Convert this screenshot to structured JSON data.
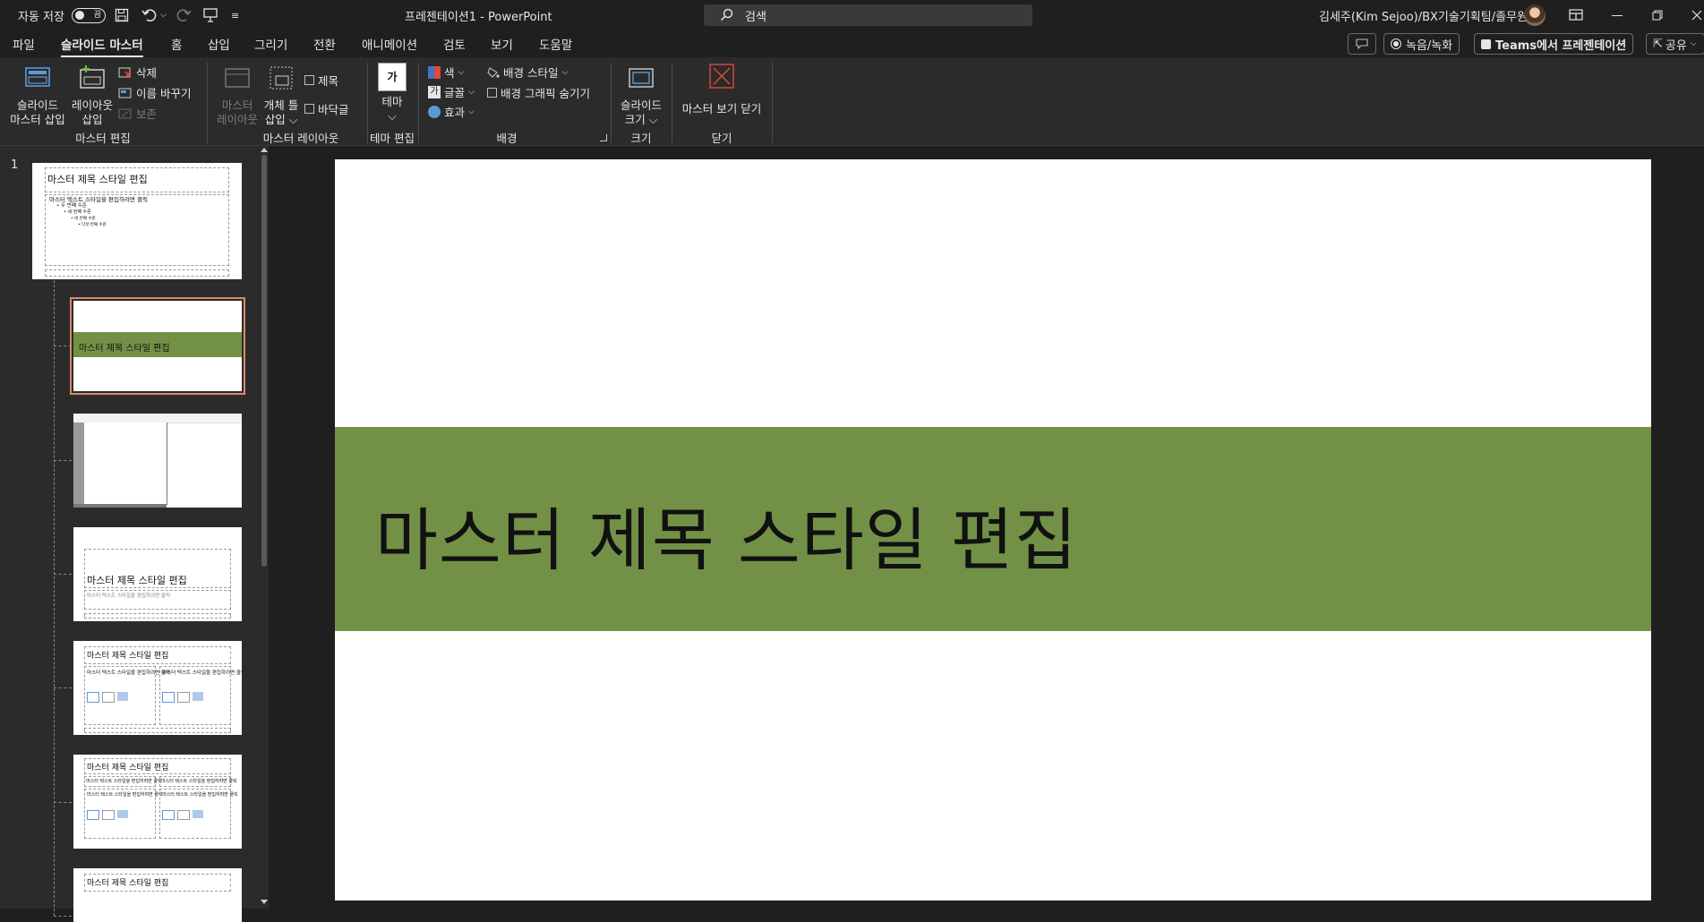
{
  "titlebar": {
    "autosave_label": "자동 저장",
    "autosave_state": "끔",
    "doc_title": "프레젠테이션1  -  PowerPoint",
    "search_placeholder": "검색",
    "user": "김세주(Kim Sejoo)/BX기술기획팀/졸무원"
  },
  "tabs": [
    "파일",
    "슬라이드 마스터",
    "홈",
    "삽입",
    "그리기",
    "전환",
    "애니메이션",
    "검토",
    "보기",
    "도움말"
  ],
  "tabs_active_index": 1,
  "ribbon_right": {
    "record": "녹음/녹화",
    "teams": "Teams에서 프레젠테이션",
    "share": "공유"
  },
  "ribbon": {
    "insert_master": "슬라이드\n마스터 삽입",
    "insert_master_l1": "슬라이드",
    "insert_master_l2": "마스터 삽입",
    "insert_layout_l1": "레이아웃",
    "insert_layout_l2": "삽입",
    "delete": "삭제",
    "rename": "이름 바꾸기",
    "preserve": "보존",
    "group_master_edit": "마스터 편집",
    "master_layout_l1": "마스터",
    "master_layout_l2": "레이아웃",
    "insert_placeholder_l1": "개체 틀",
    "insert_placeholder_l2": "삽입",
    "title_cb": "제목",
    "footer_cb": "바닥글",
    "group_master_layout": "마스터 레이아웃",
    "theme": "테마",
    "group_theme_edit": "테마 편집",
    "colors": "색",
    "fonts": "글꼴",
    "effects": "효과",
    "bg_styles": "배경 스타일",
    "hide_bg": "배경 그래픽 숨기기",
    "group_background": "배경",
    "slide_size_l1": "슬라이드",
    "slide_size_l2": "크기",
    "group_size": "크기",
    "close_master": "마스터 보기 닫기",
    "group_close": "닫기"
  },
  "thumbnails": {
    "slide_number": "1",
    "master_title": "마스터 제목 스타일 편집",
    "master_body": [
      "마스터 텍스트 스타일을 편집하려면 클릭",
      "• 두 번째 수준",
      "• 세 번째 수준",
      "• 네 번째 수준",
      "• 다섯 번째 수준"
    ],
    "layout_title": "마스터 제목 스타일 편집",
    "layout_sub": "마스터 텍스트 스타일을 편집하려면 클릭",
    "layout_col_text": "마스터 텍스트 스타일을 편집하려면 클릭"
  },
  "slide": {
    "title": "마스터 제목 스타일 편집",
    "band_color": "#739146"
  }
}
